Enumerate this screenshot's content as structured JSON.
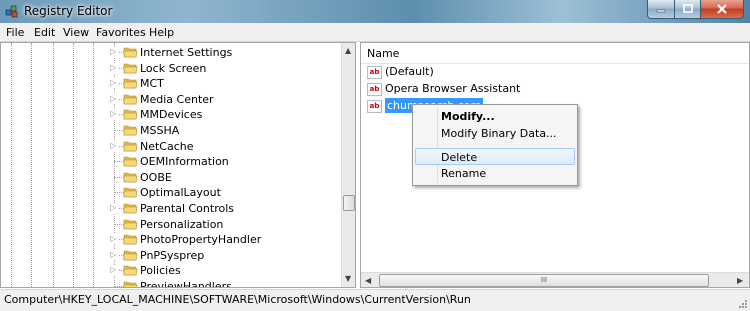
{
  "window": {
    "title": "Registry Editor"
  },
  "menu": {
    "items": [
      "File",
      "Edit",
      "View",
      "Favorites",
      "Help"
    ]
  },
  "tree": {
    "items": [
      {
        "label": "Internet Settings",
        "expandable": true
      },
      {
        "label": "Lock Screen",
        "expandable": true
      },
      {
        "label": "MCT",
        "expandable": true
      },
      {
        "label": "Media Center",
        "expandable": true
      },
      {
        "label": "MMDevices",
        "expandable": true
      },
      {
        "label": "MSSHA",
        "expandable": false
      },
      {
        "label": "NetCache",
        "expandable": true
      },
      {
        "label": "OEMInformation",
        "expandable": false
      },
      {
        "label": "OOBE",
        "expandable": false
      },
      {
        "label": "OptimalLayout",
        "expandable": false
      },
      {
        "label": "Parental Controls",
        "expandable": true
      },
      {
        "label": "Personalization",
        "expandable": false
      },
      {
        "label": "PhotoPropertyHandler",
        "expandable": true
      },
      {
        "label": "PnPSysprep",
        "expandable": true
      },
      {
        "label": "Policies",
        "expandable": true
      },
      {
        "label": "PreviewHandlers",
        "expandable": false
      }
    ]
  },
  "list": {
    "column_header": "Name",
    "items": [
      {
        "name": "(Default)",
        "selected": false
      },
      {
        "name": "Opera Browser Assistant",
        "selected": false
      },
      {
        "name": "chumsearch.com",
        "selected": true
      }
    ],
    "hscroll_grip": "III"
  },
  "context_menu": {
    "items": [
      "Modify...",
      "Modify Binary Data...",
      "Delete",
      "Rename"
    ],
    "highlighted": "Delete"
  },
  "status": {
    "path": "Computer\\HKEY_LOCAL_MACHINE\\SOFTWARE\\Microsoft\\Windows\\CurrentVersion\\Run"
  },
  "colors": {
    "selection": "#3399ff",
    "titlebar": "#6c9ab8",
    "close_button": "#c23d1f"
  },
  "icons": {
    "title": "registry-editor-icon",
    "tree_item": "folder-icon",
    "list_item": "reg-sz-string-icon",
    "expand": "expand-triangle-icon"
  }
}
